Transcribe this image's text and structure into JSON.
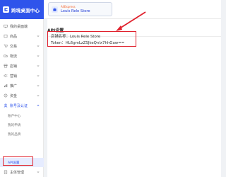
{
  "header": {
    "app_name": "跨境桌面中心",
    "store_platform": "AliExpress",
    "store_name": "Louis Rele Store"
  },
  "sidebar": {
    "items": [
      {
        "label": "我的桌面端",
        "icon": "desktop-icon"
      },
      {
        "label": "商品",
        "icon": "box-icon"
      },
      {
        "label": "交易",
        "icon": "cart-icon"
      },
      {
        "label": "物流",
        "icon": "truck-icon"
      },
      {
        "label": "店铺",
        "icon": "shop-icon"
      },
      {
        "label": "营销",
        "icon": "megaphone-icon"
      },
      {
        "label": "推广",
        "icon": "chart-icon"
      },
      {
        "label": "资金",
        "icon": "wallet-icon"
      },
      {
        "label": "账号及认证",
        "icon": "user-icon"
      },
      {
        "label": "主体管理",
        "icon": "building-icon"
      }
    ],
    "sub_items": [
      {
        "label": "账户中心"
      },
      {
        "label": "我的申请"
      },
      {
        "label": "我的品牌"
      },
      {
        "label": "API设置"
      }
    ]
  },
  "main": {
    "page_title": "API设置",
    "store_line": "店铺名称：Louis Rele Store",
    "token_line": "Token：HL6gmLzZSJkeQnlx7hhGaw=="
  },
  "colors": {
    "brand_blue": "#2f54eb",
    "highlight_red": "#e0202c",
    "platform_orange": "#f5642d"
  }
}
